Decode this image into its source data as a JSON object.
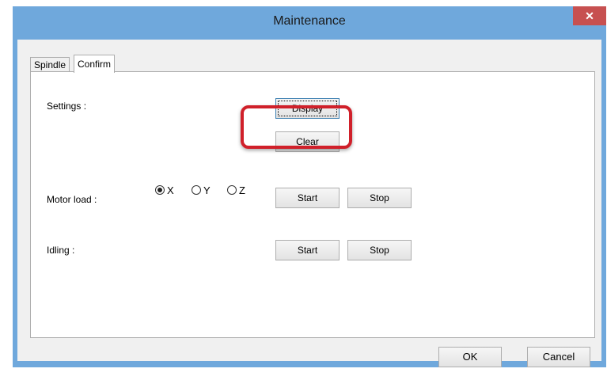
{
  "window": {
    "title": "Maintenance",
    "close_icon": "close-icon"
  },
  "tabs": [
    {
      "label": "Spindle",
      "active": false
    },
    {
      "label": "Confirm",
      "active": true
    }
  ],
  "settings": {
    "label": "Settings :",
    "display_label": "Display",
    "clear_label": "Clear"
  },
  "motor_load": {
    "label": "Motor load :",
    "axes": [
      {
        "label": "X",
        "checked": true
      },
      {
        "label": "Y",
        "checked": false
      },
      {
        "label": "Z",
        "checked": false
      }
    ],
    "start_label": "Start",
    "stop_label": "Stop"
  },
  "idling": {
    "label": "Idling :",
    "start_label": "Start",
    "stop_label": "Stop"
  },
  "footer": {
    "ok_label": "OK",
    "cancel_label": "Cancel"
  },
  "colors": {
    "titlebar": "#6fa8dc",
    "close": "#c75050",
    "highlight": "#d0202a"
  }
}
